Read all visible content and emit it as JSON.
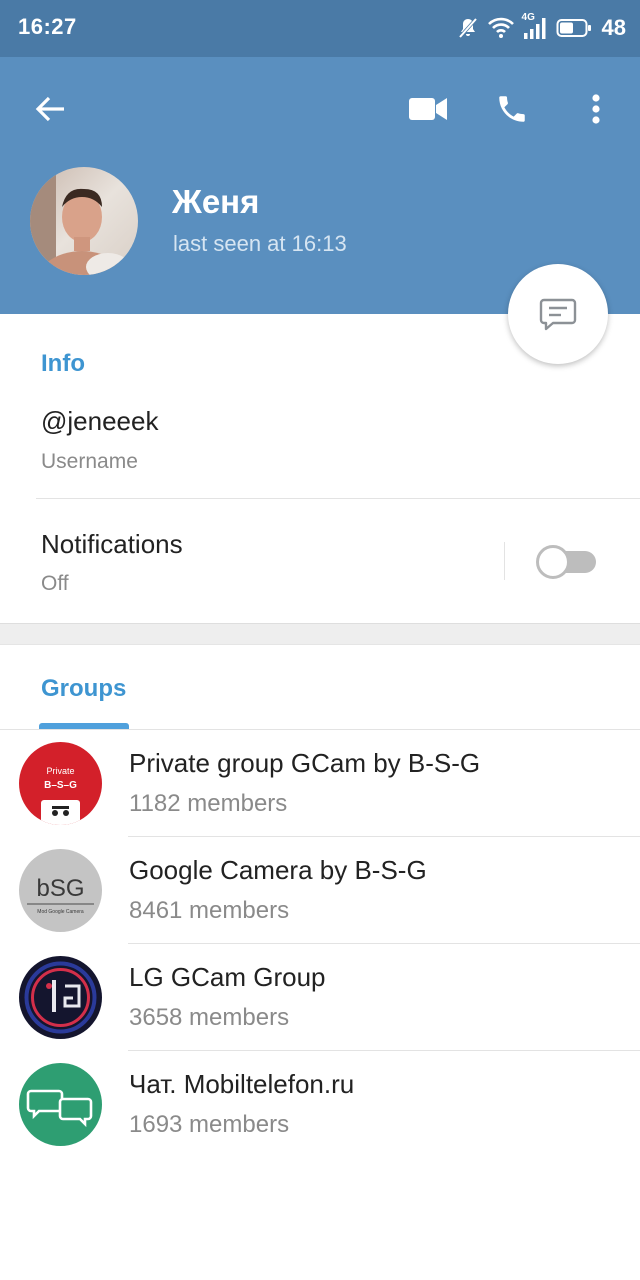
{
  "status_bar": {
    "time": "16:27",
    "network": "4G",
    "battery": "48",
    "icons": [
      "notifications-muted-icon",
      "wifi-icon",
      "signal-icon",
      "battery-icon"
    ]
  },
  "header": {
    "name": "Женя",
    "last_seen": "last seen at 16:13",
    "icons": [
      "back-arrow-icon",
      "video-camera-icon",
      "phone-icon",
      "more-vert-icon",
      "message-icon"
    ]
  },
  "info": {
    "title": "Info",
    "username": "@jeneeek",
    "username_label": "Username",
    "notifications_label": "Notifications",
    "notifications_value": "Off",
    "notifications_enabled": false
  },
  "groups": {
    "tab_label": "Groups",
    "items": [
      {
        "name": "Private group GCam by B-S-G",
        "members": "1182 members",
        "avatar_text": "Private",
        "avatar_sub": "B–S–G"
      },
      {
        "name": "Google Camera by B-S-G",
        "members": "8461 members",
        "avatar_text": "bSG",
        "avatar_sub": "Mod Google Camera"
      },
      {
        "name": "LG GCam Group",
        "members": "3658 members"
      },
      {
        "name": "Чат. Mobiltelefon.ru",
        "members": "1693 members"
      }
    ]
  },
  "colors": {
    "status_bar": "#4a7aa6",
    "header": "#5a8fbf",
    "accent": "#3e95d1",
    "secondary_text": "#8a8a8a"
  }
}
